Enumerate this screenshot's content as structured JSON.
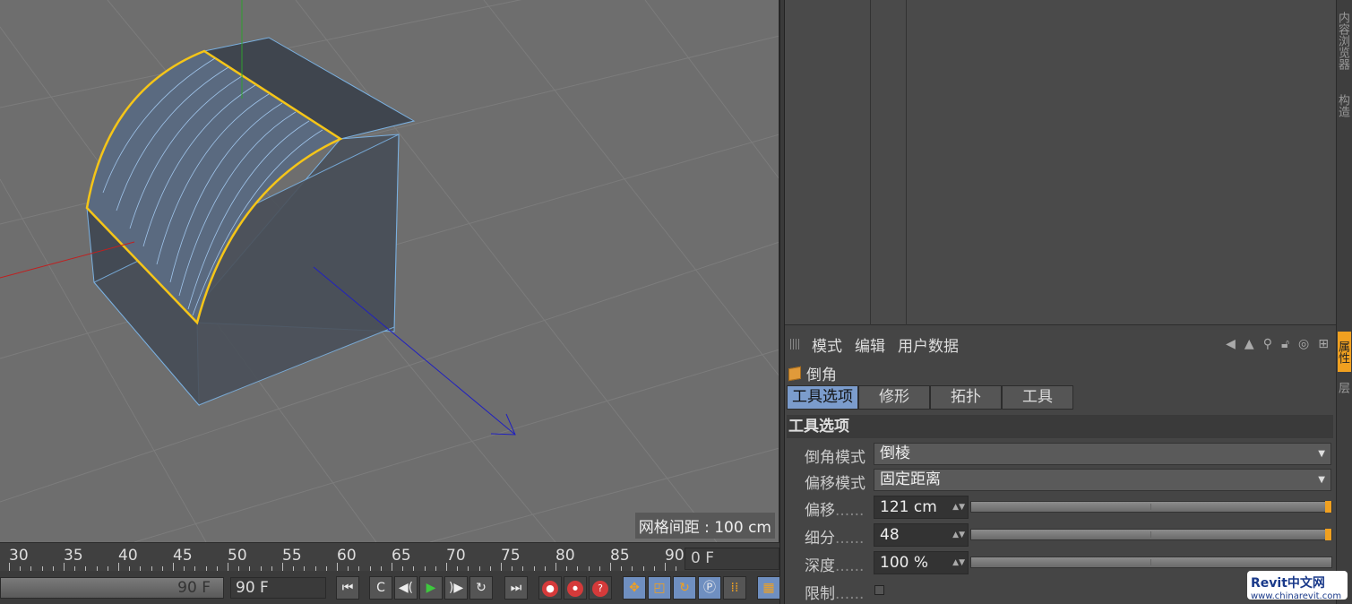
{
  "viewport": {
    "grid_label": "网格间距 : 100 cm"
  },
  "side_tabs": [
    "内容浏览器",
    "构造",
    "属性",
    "层"
  ],
  "attributes": {
    "menu": [
      "模式",
      "编辑",
      "用户数据"
    ],
    "tool_name": "倒角",
    "tabs": [
      "工具选项",
      "修形",
      "拓扑",
      "工具"
    ],
    "active_tab": "工具选项",
    "section_title": "工具选项",
    "fields": {
      "bevel_mode_label": "倒角模式",
      "bevel_mode_value": "倒棱",
      "offset_mode_label": "偏移模式",
      "offset_mode_value": "固定距离",
      "offset_label": "偏移",
      "offset_value": "121 cm",
      "subdiv_label": "细分",
      "subdiv_value": "48",
      "depth_label": "深度",
      "depth_value": "100 %",
      "limit_label": "限制",
      "dots": "......"
    }
  },
  "timeline": {
    "ticks": [
      "30",
      "35",
      "40",
      "45",
      "50",
      "55",
      "60",
      "65",
      "70",
      "75",
      "80",
      "85",
      "90"
    ],
    "current_frame": "0 F"
  },
  "transport": {
    "range_end_display": "90 F",
    "end_frame": "90 F",
    "buttons": [
      "⏮",
      "C",
      "◀(",
      "▶",
      ")▶",
      "↻",
      "⏭"
    ]
  },
  "logo": {
    "name": "Revit中文网",
    "url": "www.chinarevit.com"
  },
  "colors": {
    "accent": "#f0a020",
    "selection": "#f5c518",
    "active_tab": "#7b9ccc"
  }
}
